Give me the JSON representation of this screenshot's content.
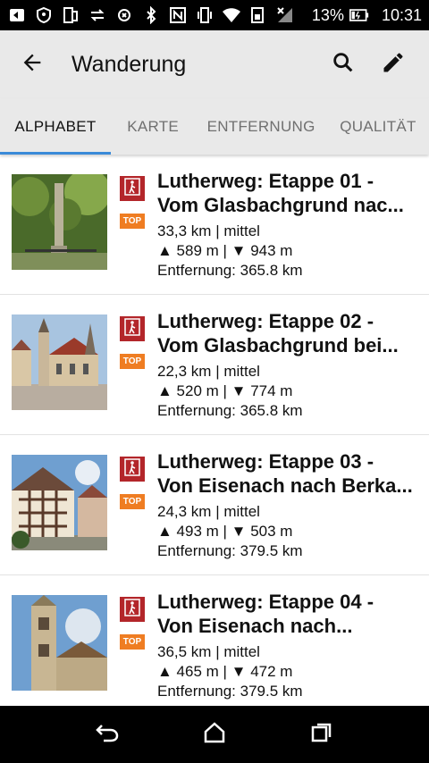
{
  "status_bar": {
    "battery_text": "13%",
    "time": "10:31",
    "icons": [
      "notification-icon",
      "vpn-icon",
      "screen-icon",
      "sync-icon",
      "refresh-icon",
      "bluetooth-icon",
      "nfc-icon",
      "vibrate-icon",
      "wifi-icon",
      "data-saver-icon",
      "signal-icon",
      "battery-icon"
    ]
  },
  "app_bar": {
    "title": "Wanderung",
    "back_icon": "arrow-back-icon",
    "search_icon": "search-icon",
    "edit_icon": "edit-icon"
  },
  "tabs": [
    {
      "label": "ALPHABET",
      "active": true
    },
    {
      "label": "KARTE",
      "active": false
    },
    {
      "label": "ENTFERNUNG",
      "active": false
    },
    {
      "label": "QUALITÄT",
      "active": false
    }
  ],
  "colors": {
    "accent": "#3a8ad8",
    "hike_badge": "#b3262a",
    "top_badge": "#ef7d22"
  },
  "routes": [
    {
      "title_line1": "Lutherweg: Etappe 01 -",
      "title_line2": "Vom Glasbachgrund nac...",
      "summary": "33,3 km | mittel",
      "elevation": "▲ 589 m | ▼ 943 m",
      "distance": "Entfernung: 365.8 km",
      "badge": "TOP"
    },
    {
      "title_line1": "Lutherweg: Etappe 02 -",
      "title_line2": "Vom Glasbachgrund bei...",
      "summary": "22,3 km | mittel",
      "elevation": "▲ 520 m | ▼ 774 m",
      "distance": "Entfernung: 365.8 km",
      "badge": "TOP"
    },
    {
      "title_line1": "Lutherweg: Etappe 03 -",
      "title_line2": "Von Eisenach nach Berka...",
      "summary": "24,3 km | mittel",
      "elevation": "▲ 493 m | ▼ 503 m",
      "distance": "Entfernung: 379.5 km",
      "badge": "TOP"
    },
    {
      "title_line1": "Lutherweg: Etappe 04 -",
      "title_line2": "Von Eisenach nach...",
      "summary": "36,5 km | mittel",
      "elevation": "▲ 465 m | ▼ 472 m",
      "distance": "Entfernung: 379.5 km",
      "badge": "TOP"
    }
  ],
  "nav_bar": {
    "back": "nav-back-icon",
    "home": "nav-home-icon",
    "recents": "nav-recents-icon"
  }
}
